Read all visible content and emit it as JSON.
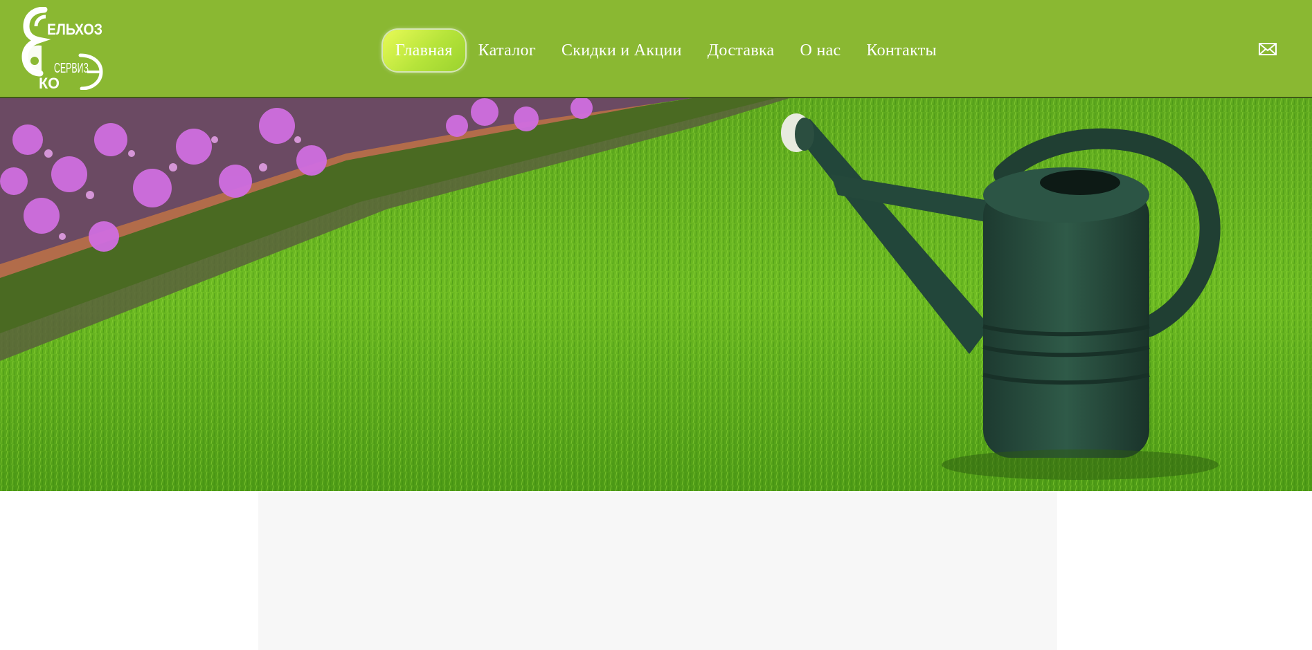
{
  "brand": {
    "logo_text_line1": "ЕЛЬХОЗ",
    "logo_text_line2": "СЕРВИЗ",
    "logo_big_letter_1": "С",
    "logo_big_letter_2": "Э",
    "logo_small": "КО",
    "color": "#ffffff"
  },
  "header": {
    "background": "#8ab832",
    "nav": [
      {
        "label": "Главная",
        "active": true
      },
      {
        "label": "Каталог",
        "active": false
      },
      {
        "label": "Скидки и Акции",
        "active": false
      },
      {
        "label": "Доставка",
        "active": false
      },
      {
        "label": "О нас",
        "active": false
      },
      {
        "label": "Контакты",
        "active": false
      }
    ],
    "mail_icon": "envelope-icon"
  },
  "hero": {
    "description_icon": "watering-can-on-lawn-image"
  },
  "colors": {
    "nav_active_start": "#e8fa56",
    "nav_active_end": "#9bd22e",
    "panel": "#f7f7f7"
  }
}
